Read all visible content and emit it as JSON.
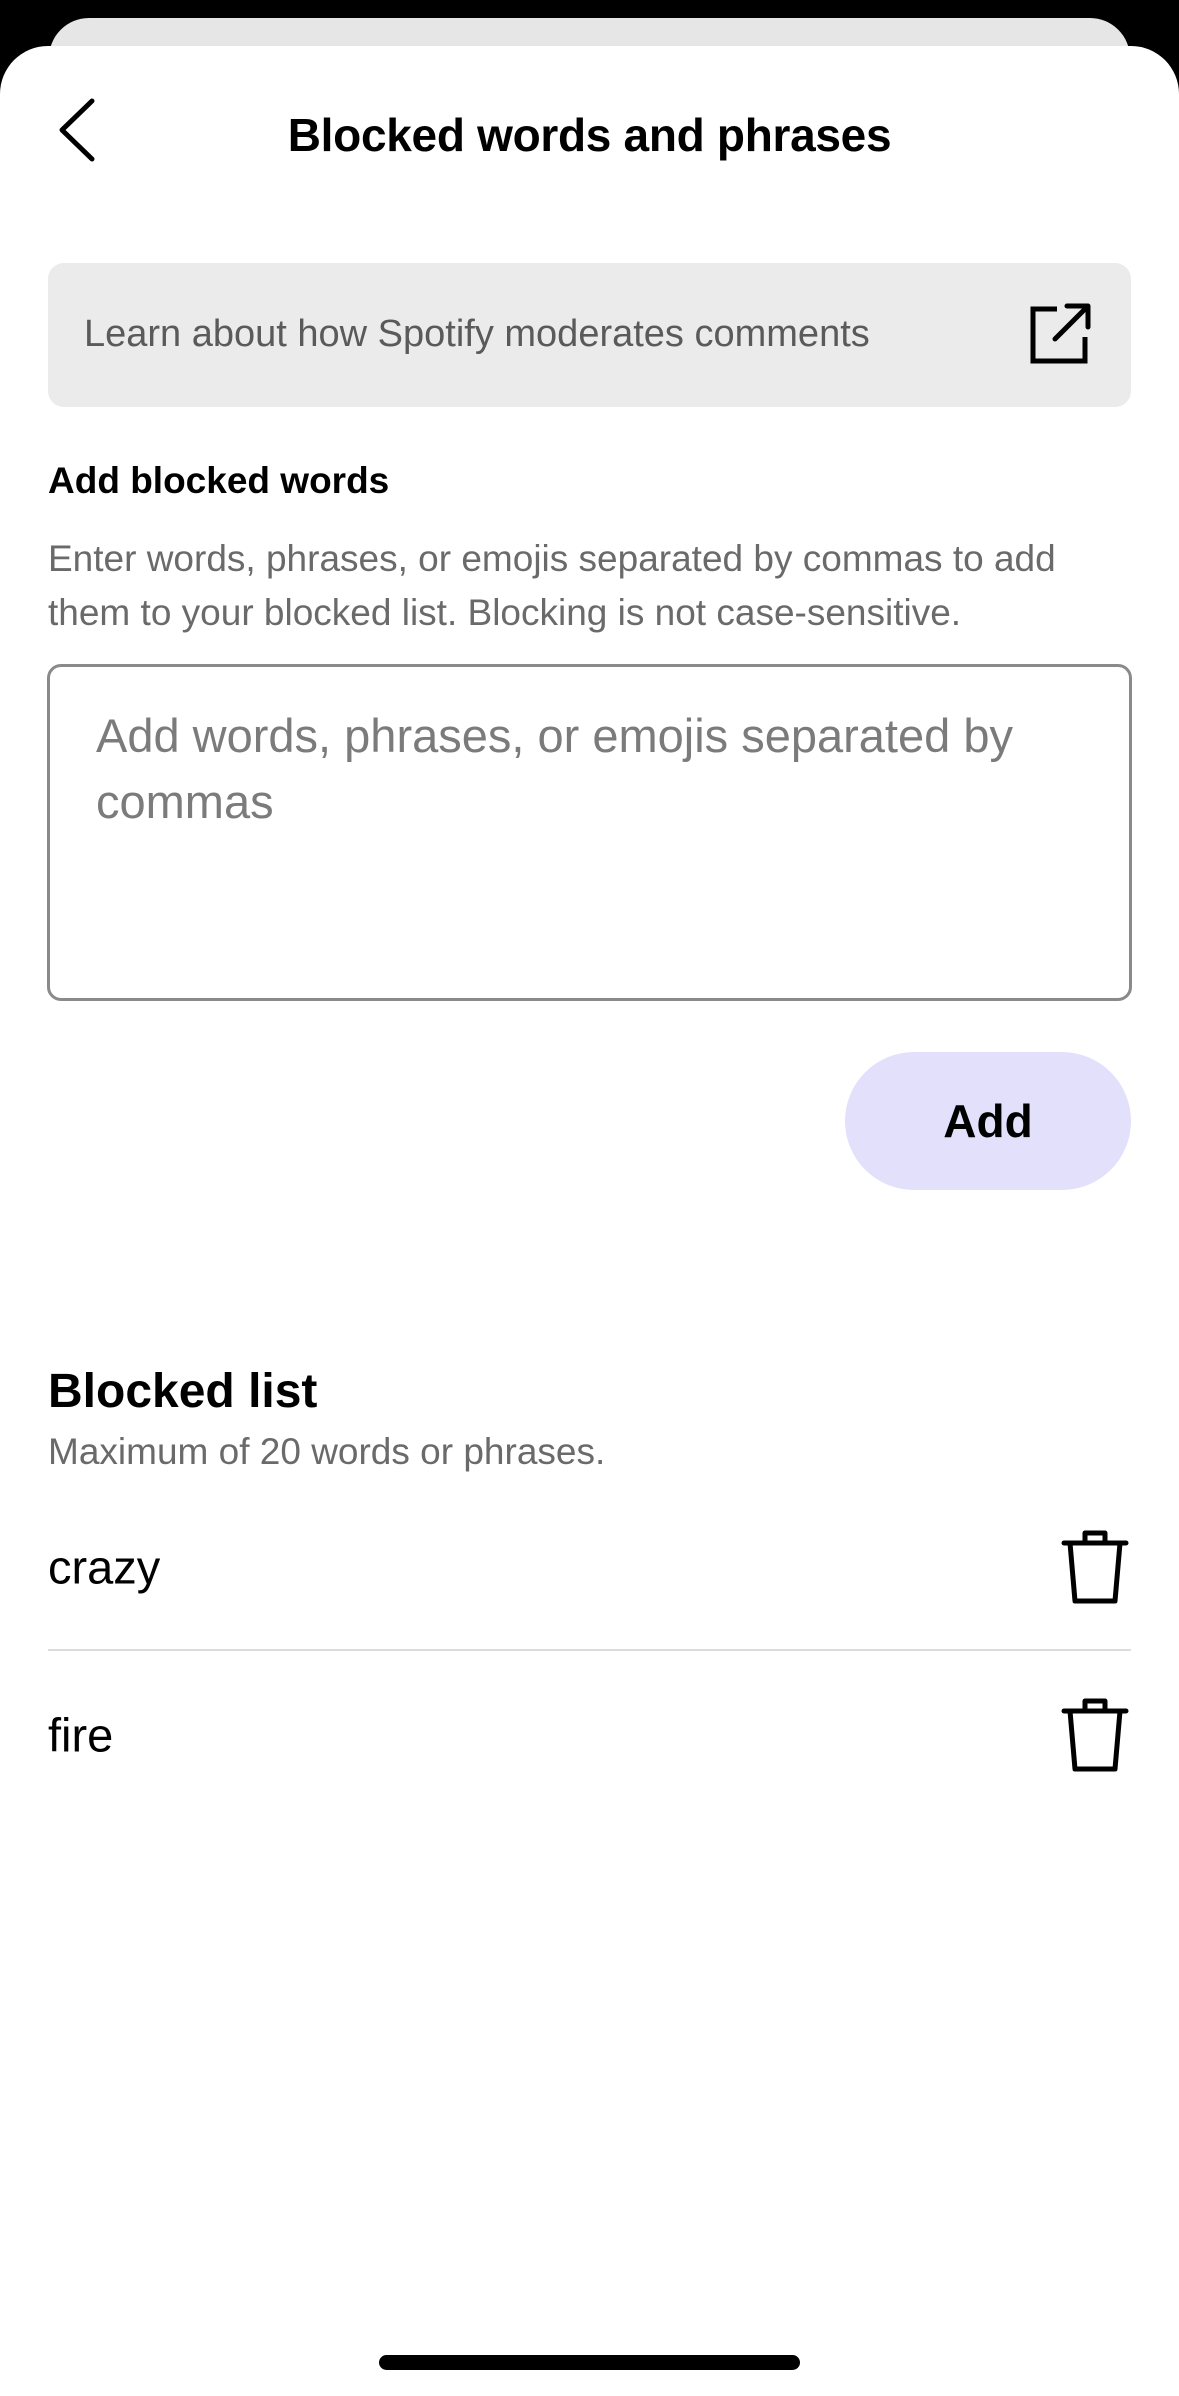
{
  "header": {
    "title": "Blocked words and phrases",
    "back_icon": "chevron-left-icon"
  },
  "learn_card": {
    "text": "Learn about how Spotify moderates comments",
    "icon": "external-link-icon"
  },
  "add_section": {
    "label": "Add blocked words",
    "description": "Enter words, phrases, or emojis separated by commas to add them to your blocked list. Blocking is not case-sensitive.",
    "input_placeholder": "Add words, phrases, or emojis separated by commas",
    "input_value": "",
    "add_label": "Add",
    "add_button_color": "#e2e0fb"
  },
  "blocked_list": {
    "title": "Blocked list",
    "subtitle": "Maximum of 20 words or phrases.",
    "items": [
      {
        "text": "crazy",
        "icon": "trash-icon"
      },
      {
        "text": "fire",
        "icon": "trash-icon"
      }
    ]
  }
}
